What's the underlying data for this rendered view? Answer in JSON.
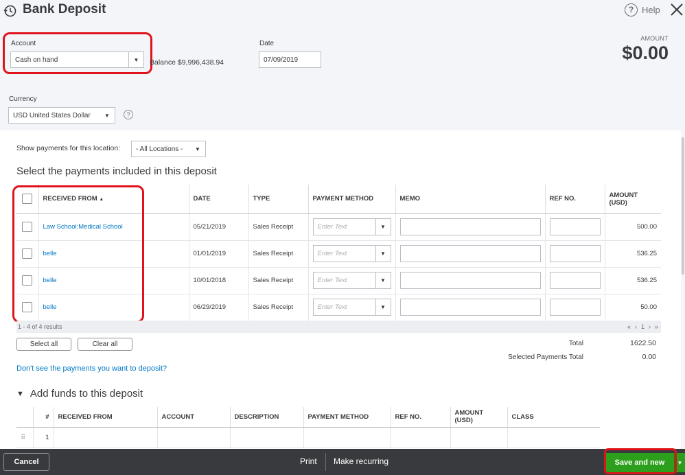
{
  "header": {
    "title": "Bank Deposit",
    "help_label": "Help",
    "amount_label": "AMOUNT",
    "amount_value": "$0.00"
  },
  "form": {
    "account_label": "Account",
    "account_value": "Cash on hand",
    "balance_text": "Balance $9,996,438.94",
    "date_label": "Date",
    "date_value": "07/09/2019",
    "currency_label": "Currency",
    "currency_value": "USD United States Dollar"
  },
  "payments": {
    "location_label": "Show payments for this location:",
    "location_value": "- All Locations -",
    "section_title": "Select the payments included in this deposit",
    "columns": [
      "RECEIVED FROM",
      "DATE",
      "TYPE",
      "PAYMENT METHOD",
      "MEMO",
      "REF NO.",
      "AMOUNT (USD)"
    ],
    "sort_indicator": "▲",
    "method_placeholder": "Enter Text",
    "rows": [
      {
        "received_from": "Law School:Medical School",
        "date": "05/21/2019",
        "type": "Sales Receipt",
        "amount": "500.00"
      },
      {
        "received_from": "belle",
        "date": "01/01/2019",
        "type": "Sales Receipt",
        "amount": "536.25"
      },
      {
        "received_from": "belle",
        "date": "10/01/2018",
        "type": "Sales Receipt",
        "amount": "536.25"
      },
      {
        "received_from": "belle",
        "date": "06/29/2019",
        "type": "Sales Receipt",
        "amount": "50.00"
      }
    ],
    "results_text": "1 - 4 of 4 results",
    "pager": {
      "first": "«",
      "prev": "‹",
      "page": "1",
      "next": "›",
      "last": "»"
    },
    "select_all_label": "Select all",
    "clear_all_label": "Clear all",
    "total_label": "Total",
    "total_value": "1622.50",
    "selected_total_label": "Selected Payments Total",
    "selected_total_value": "0.00",
    "missing_link": "Don't see the payments you want to deposit?"
  },
  "add_funds": {
    "title": "Add funds to this deposit",
    "columns": [
      "#",
      "RECEIVED FROM",
      "ACCOUNT",
      "DESCRIPTION",
      "PAYMENT METHOD",
      "REF NO.",
      "AMOUNT (USD)",
      "CLASS"
    ],
    "first_row_number": "1"
  },
  "footer": {
    "cancel_label": "Cancel",
    "print_label": "Print",
    "recurring_label": "Make recurring",
    "save_label": "Save and new"
  },
  "colors": {
    "accent_green": "#2ca01c",
    "link_blue": "#0077c5",
    "highlight_red": "#e0121a",
    "footer_bg": "#393a3d"
  },
  "icons": [
    "history-icon",
    "help-icon",
    "close-icon",
    "chevron-down-icon",
    "drag-handle-icon",
    "collapse-triangle-icon"
  ]
}
